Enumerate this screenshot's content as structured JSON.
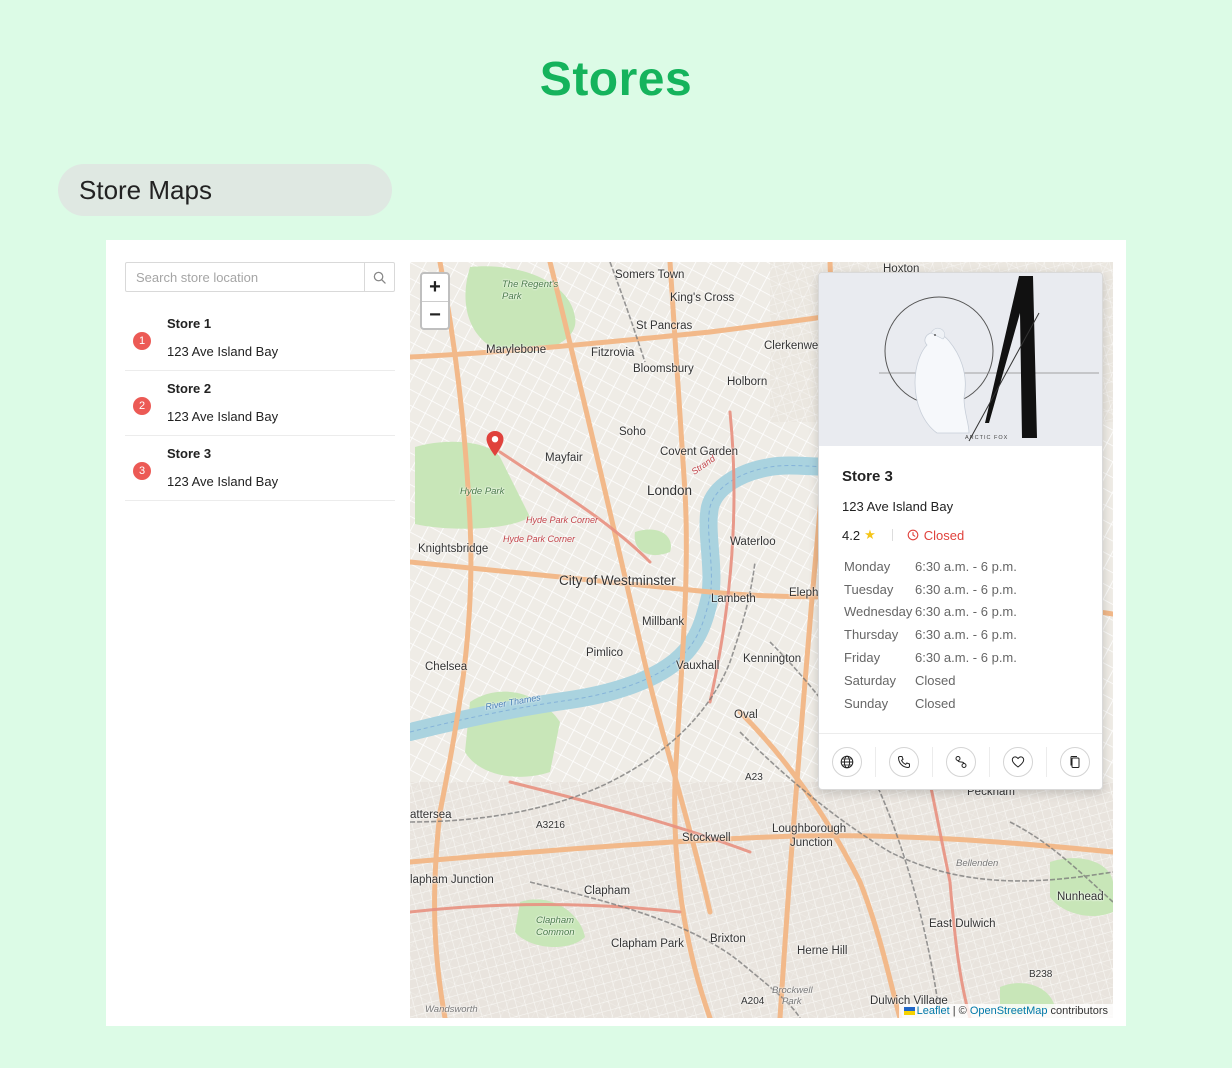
{
  "page": {
    "title": "Stores",
    "section_title": "Store Maps"
  },
  "search": {
    "placeholder": "Search store location",
    "value": ""
  },
  "stores": [
    {
      "badge": "1",
      "name": "Store 1",
      "address": "123 Ave Island Bay"
    },
    {
      "badge": "2",
      "name": "Store 2",
      "address": "123 Ave Island Bay"
    },
    {
      "badge": "3",
      "name": "Store 3",
      "address": "123 Ave Island Bay"
    }
  ],
  "map": {
    "zoom_in": "+",
    "zoom_out": "−",
    "attribution": {
      "leaflet": "Leaflet",
      "separator": " | © ",
      "osm": "OpenStreetMap",
      "suffix": " contributors"
    },
    "labels": {
      "hoxton": "Hoxton",
      "somers_town": "Somers Town",
      "kings_cross": "King's Cross",
      "regents_park": "The Regent's Park",
      "st_pancras": "St Pancras",
      "marylebone": "Marylebone",
      "fitzrovia": "Fitzrovia",
      "clerkenwell": "Clerkenwel",
      "bloomsbury": "Bloomsbury",
      "holborn": "Holborn",
      "soho": "Soho",
      "mayfair": "Mayfair",
      "covent_garden": "Covent Garden",
      "strand": "Strand",
      "london": "London",
      "hyde_park": "Hyde Park",
      "hyde_park_corner": "Hyde Park Corner",
      "hyde_park_corner_2": "Hyde Park Corner",
      "knightsbridge": "Knightsbridge",
      "waterloo": "Waterloo",
      "westminster": "City of Westminster",
      "elephant": "Eleph",
      "lambeth": "Lambeth",
      "millbank": "Millbank",
      "pimlico": "Pimlico",
      "chelsea": "Chelsea",
      "vauxhall": "Vauxhall",
      "kennington": "Kennington",
      "oval": "Oval",
      "thames": "River Thames",
      "a23": "A23",
      "peckham": "Peckham",
      "battersea": "attersea",
      "a3216": "A3216",
      "stockwell": "Stockwell",
      "loughborough": "Loughborough",
      "junction": "Junction",
      "bellenden": "Bellenden",
      "clapham_junction": "lapham Junction",
      "clapham": "Clapham",
      "nunhead": "Nunhead",
      "clapham_common": "Clapham",
      "clapham_common_2": "Common",
      "east_dulwich": "East Dulwich",
      "clapham_park": "Clapham Park",
      "brixton": "Brixton",
      "herne_hill": "Herne Hill",
      "b238": "B238",
      "brockwell": "Brockwell",
      "brockwell_2": "Park",
      "a204": "A204",
      "dulwich_village": "Dulwich Village",
      "wandsworth": "Wandsworth"
    }
  },
  "popup": {
    "name": "Store 3",
    "address": "123 Ave Island Bay",
    "rating": "4.2",
    "status": "Closed",
    "logo_caption": "ARCTIC FOX",
    "hours": [
      {
        "day": "Monday",
        "time": "6:30 a.m. - 6 p.m."
      },
      {
        "day": "Tuesday",
        "time": "6:30 a.m. - 6 p.m."
      },
      {
        "day": "Wednesday",
        "time": "6:30 a.m. - 6 p.m."
      },
      {
        "day": "Thursday",
        "time": "6:30 a.m. - 6 p.m."
      },
      {
        "day": "Friday",
        "time": "6:30 a.m. - 6 p.m."
      },
      {
        "day": "Saturday",
        "time": "Closed"
      },
      {
        "day": "Sunday",
        "time": "Closed"
      }
    ],
    "actions": [
      "globe-icon",
      "phone-icon",
      "directions-icon",
      "heart-icon",
      "copy-icon"
    ]
  },
  "colors": {
    "background": "#dcfbe6",
    "title": "#15b35c",
    "badge": "#ec5a55",
    "closed": "#e0423c",
    "star": "#f5c518",
    "link": "#0078a8"
  }
}
